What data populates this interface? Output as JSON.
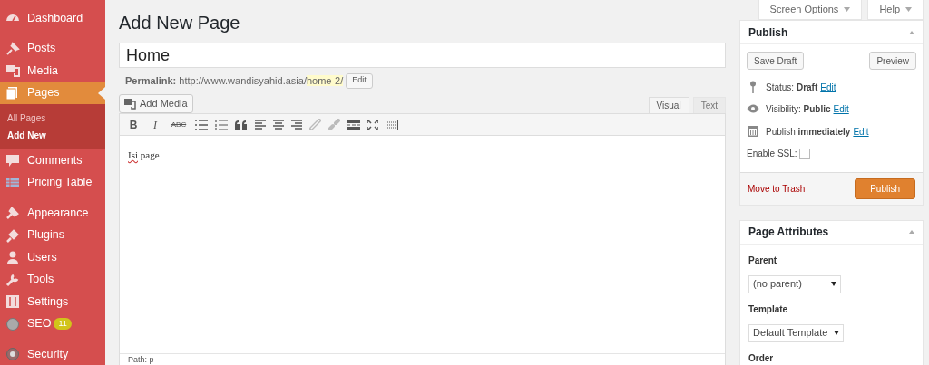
{
  "sidebar": {
    "sections": [
      [
        {
          "label": "Dashboard",
          "selected": false
        }
      ],
      [
        {
          "label": "Posts",
          "selected": false
        },
        {
          "label": "Media",
          "selected": false
        },
        {
          "label": "Pages",
          "selected": true,
          "children": [
            {
              "label": "All Pages",
              "selected": false
            },
            {
              "label": "Add New",
              "selected": true
            }
          ]
        },
        {
          "label": "Comments",
          "selected": false
        },
        {
          "label": "Pricing Table",
          "selected": false
        }
      ],
      [
        {
          "label": "Appearance",
          "selected": false
        },
        {
          "label": "Plugins",
          "selected": false
        },
        {
          "label": "Users",
          "selected": false
        },
        {
          "label": "Tools",
          "selected": false
        },
        {
          "label": "Settings",
          "selected": false
        },
        {
          "label": "SEO",
          "selected": false,
          "badge": "11"
        }
      ],
      [
        {
          "label": "Security",
          "selected": false
        }
      ]
    ]
  },
  "top_buttons": [
    "Screen Options",
    "Help"
  ],
  "heading": "Add New Page",
  "title_field": {
    "value": "Home"
  },
  "permalink": {
    "label": "Permalink:",
    "base": "http://www.wandisyahid.asia/",
    "slug": "home-2/",
    "button": "Edit"
  },
  "add_media": "Add Media",
  "editor_tabs": [
    {
      "label": "Visual",
      "selected": true
    },
    {
      "label": "Text",
      "selected": false
    }
  ],
  "toolbar": [
    {
      "kind": "bold",
      "label": "B"
    },
    {
      "kind": "italic",
      "label": "I"
    },
    {
      "kind": "strike",
      "label": "ABC"
    },
    {
      "kind": "bullets"
    },
    {
      "kind": "numbers"
    },
    {
      "kind": "quote"
    },
    {
      "kind": "align-left"
    },
    {
      "kind": "align-center"
    },
    {
      "kind": "align-right"
    },
    {
      "kind": "link"
    },
    {
      "kind": "unlink"
    },
    {
      "kind": "more"
    },
    {
      "kind": "fullscreen"
    },
    {
      "kind": "keyboard"
    }
  ],
  "editor_content": "Isi page",
  "path": "Path: p",
  "publish": {
    "title": "Publish",
    "save_draft": "Save Draft",
    "preview": "Preview",
    "rows": [
      {
        "kind": "status",
        "label": "Status:",
        "value": "Draft",
        "link": "Edit"
      },
      {
        "kind": "visibility",
        "label": "Visibility:",
        "value": "Public",
        "link": "Edit"
      },
      {
        "kind": "schedule",
        "label": "Publish",
        "value": "immediately",
        "link": "Edit"
      }
    ],
    "ssl": {
      "label": "Enable SSL:",
      "checked": false
    },
    "trash": "Move to Trash",
    "button": "Publish"
  },
  "page_attributes": {
    "title": "Page Attributes",
    "parent_label": "Parent",
    "parent_value": "(no parent)",
    "template_label": "Template",
    "template_value": "Default Template",
    "order_label": "Order"
  }
}
